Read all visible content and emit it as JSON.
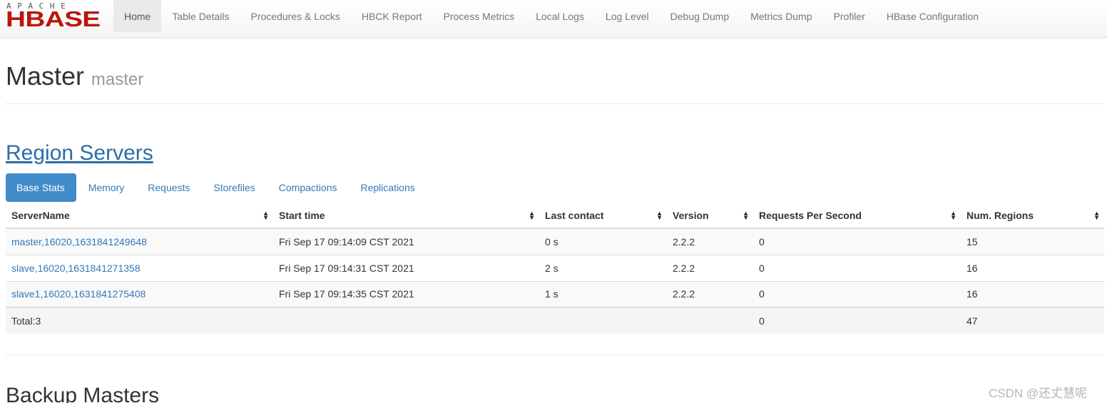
{
  "logo": {
    "top_text": "APACHE",
    "main_text": "HBASE",
    "brand_color": "#ba160c"
  },
  "nav": {
    "items": [
      {
        "label": "Home",
        "active": true
      },
      {
        "label": "Table Details"
      },
      {
        "label": "Procedures & Locks"
      },
      {
        "label": "HBCK Report"
      },
      {
        "label": "Process Metrics"
      },
      {
        "label": "Local Logs"
      },
      {
        "label": "Log Level"
      },
      {
        "label": "Debug Dump"
      },
      {
        "label": "Metrics Dump"
      },
      {
        "label": "Profiler"
      },
      {
        "label": "HBase Configuration"
      }
    ]
  },
  "header": {
    "title": "Master",
    "subtitle": "master"
  },
  "region_servers": {
    "title": "Region Servers",
    "tabs": [
      {
        "label": "Base Stats",
        "active": true
      },
      {
        "label": "Memory"
      },
      {
        "label": "Requests"
      },
      {
        "label": "Storefiles"
      },
      {
        "label": "Compactions"
      },
      {
        "label": "Replications"
      }
    ],
    "columns": [
      "ServerName",
      "Start time",
      "Last contact",
      "Version",
      "Requests Per Second",
      "Num. Regions"
    ],
    "rows": [
      {
        "server": "master,16020,1631841249648",
        "start": "Fri Sep 17 09:14:09 CST 2021",
        "contact": "0 s",
        "version": "2.2.2",
        "rps": "0",
        "regions": "15"
      },
      {
        "server": "slave,16020,1631841271358",
        "start": "Fri Sep 17 09:14:31 CST 2021",
        "contact": "2 s",
        "version": "2.2.2",
        "rps": "0",
        "regions": "16"
      },
      {
        "server": "slave1,16020,1631841275408",
        "start": "Fri Sep 17 09:14:35 CST 2021",
        "contact": "1 s",
        "version": "2.2.2",
        "rps": "0",
        "regions": "16"
      }
    ],
    "total": {
      "label": "Total:3",
      "rps": "0",
      "regions": "47"
    }
  },
  "backup_masters": {
    "title": "Backup Masters"
  },
  "watermark": "CSDN @还𠀋慧呢",
  "icons": {
    "sort": "sort-both-icon"
  },
  "colors": {
    "link": "#337ab7",
    "active_tab": "#428bca",
    "section_link": "#2a6ea8"
  }
}
